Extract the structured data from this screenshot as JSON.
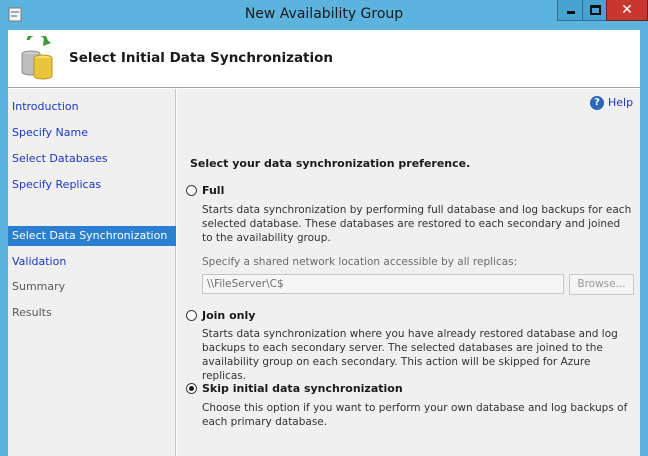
{
  "window": {
    "title": "New Availability Group",
    "controls": {
      "minimize": "minimize",
      "maximize": "maximize",
      "close": "✕"
    }
  },
  "header": {
    "title": "Select Initial Data Synchronization"
  },
  "nav": {
    "items": [
      {
        "label": "Introduction",
        "state": "link"
      },
      {
        "label": "Specify Name",
        "state": "link"
      },
      {
        "label": "Select Databases",
        "state": "link"
      },
      {
        "label": "Specify Replicas",
        "state": "link"
      },
      {
        "label": "Select Data Synchronization",
        "state": "active"
      },
      {
        "label": "Validation",
        "state": "link"
      },
      {
        "label": "Summary",
        "state": "disabled"
      },
      {
        "label": "Results",
        "state": "disabled"
      }
    ]
  },
  "content": {
    "help_label": "Help",
    "preference_label": "Select your data synchronization preference.",
    "options": {
      "full": {
        "label": "Full",
        "checked": false,
        "description": "Starts data synchronization by performing full database and log backups for each selected database. These databases are restored to each secondary and joined to the availability group."
      },
      "join_only": {
        "label": "Join only",
        "checked": false,
        "description": "Starts data synchronization where you have already restored database and log backups to each secondary server. The selected databases are joined to the availability group on each secondary. This action will be skipped for Azure replicas."
      },
      "skip": {
        "label": "Skip initial data synchronization",
        "checked": true,
        "description": "Choose this option if you want to perform your own database and log backups of each primary database."
      }
    },
    "share": {
      "label": "Specify a shared network location accessible by all replicas:",
      "value": "\\\\FileServer\\C$",
      "browse_label": "Browse..."
    }
  },
  "colors": {
    "titlebar": "#5cb3de",
    "active_nav": "#2a80d0",
    "link": "#1c36c4",
    "close_button": "#c7372f"
  }
}
